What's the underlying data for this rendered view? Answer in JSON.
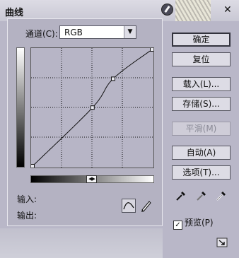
{
  "dialog": {
    "title": "曲线"
  },
  "channel": {
    "label": "通道(C):",
    "value": "RGB"
  },
  "curve": {
    "points": [
      [
        0,
        0
      ],
      [
        128,
        128
      ],
      [
        172,
        191
      ],
      [
        255,
        255
      ]
    ]
  },
  "readouts": {
    "input_label": "输入:",
    "output_label": "输出:"
  },
  "buttons": {
    "ok": "确定",
    "reset": "复位",
    "load": "载入(L)...",
    "save": "存储(S)...",
    "smooth": "平滑(M)",
    "auto": "自动(A)",
    "options": "选项(T)..."
  },
  "preview": {
    "label": "预览(P)",
    "checked": true
  },
  "icons": {
    "help": "help-icon",
    "close": "close-icon",
    "curve_tool": "curve-tool-icon",
    "pencil_tool": "pencil-icon",
    "eyedroppers": [
      "black-eyedropper-icon",
      "gray-eyedropper-icon",
      "white-eyedropper-icon"
    ],
    "resize": "resize-icon"
  }
}
